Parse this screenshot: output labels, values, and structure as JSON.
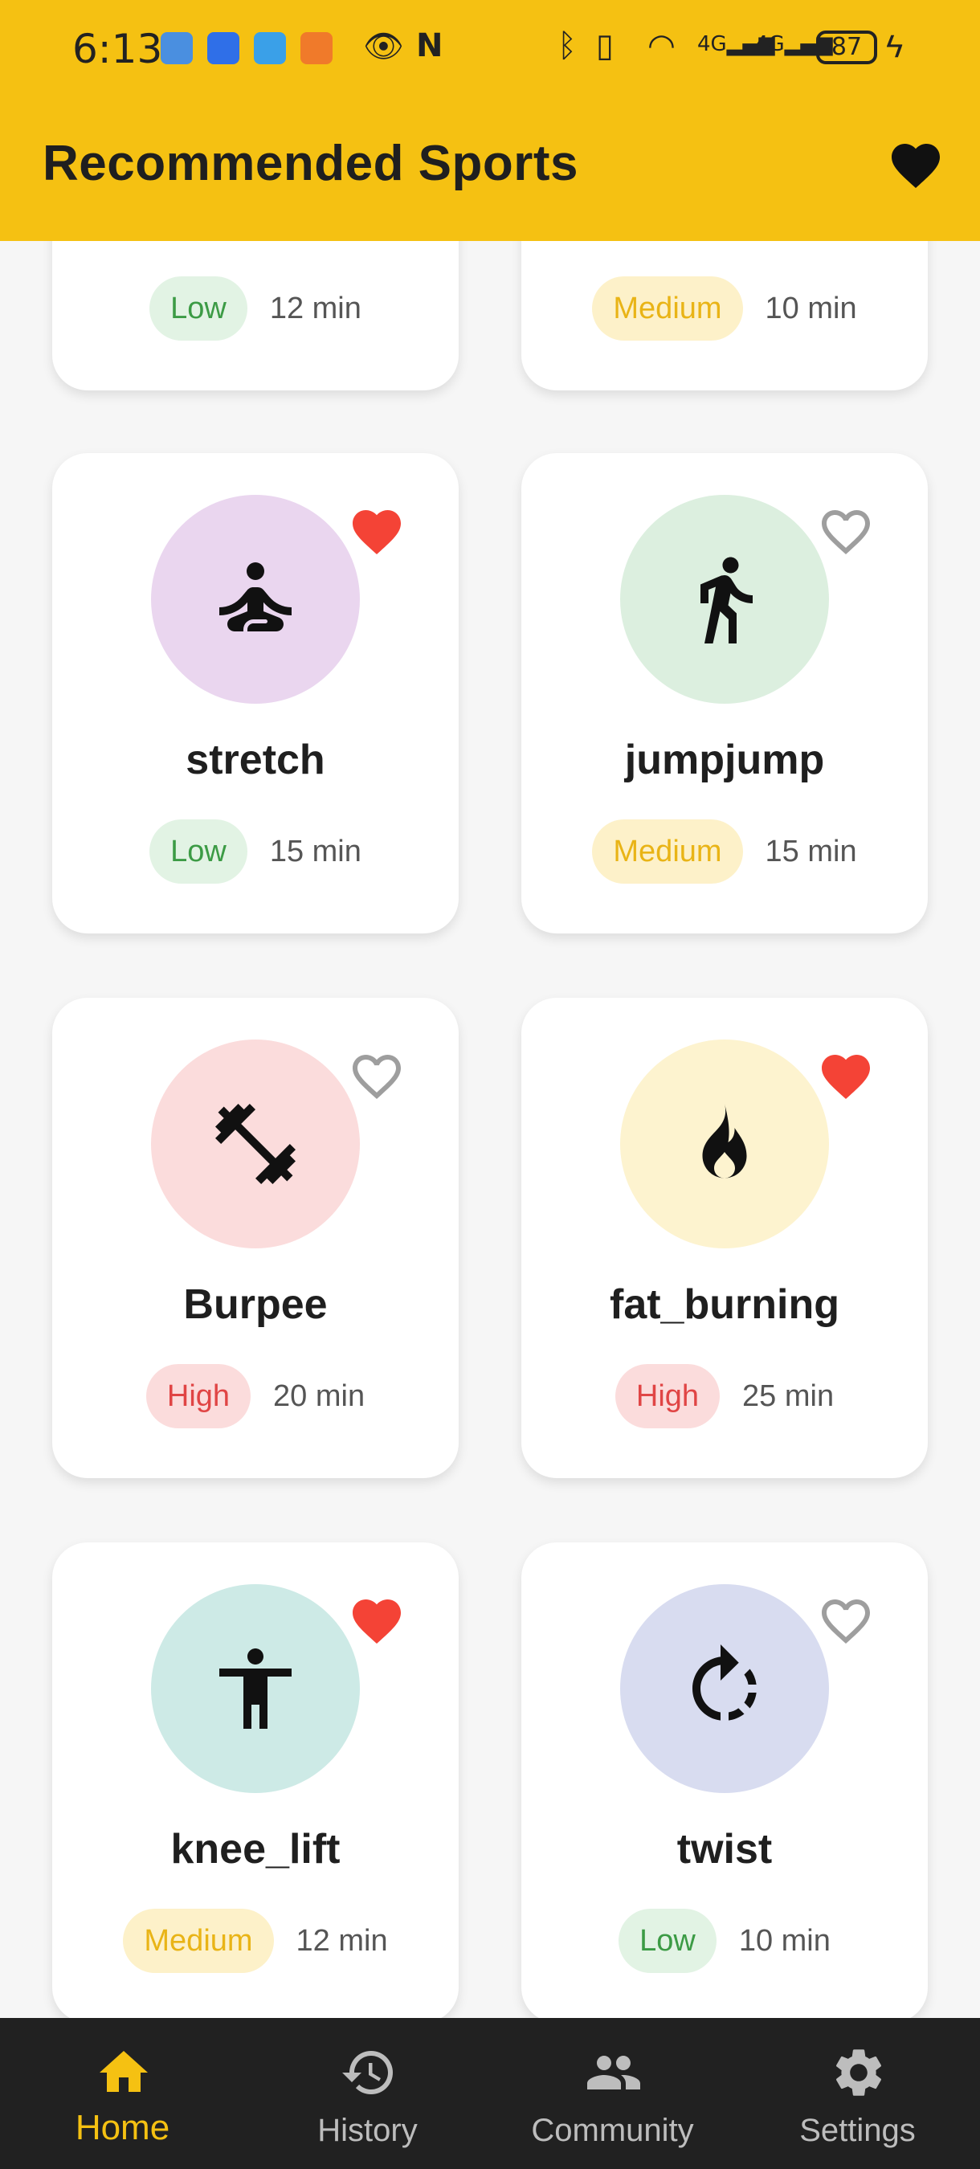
{
  "status_bar": {
    "time": "6:13",
    "battery": "87"
  },
  "header": {
    "title": "Recommended Sports",
    "favorites_icon": "heart-icon"
  },
  "cards": [
    {
      "name": "",
      "level": "Low",
      "level_class": "low",
      "duration": "12 min",
      "favorited": false,
      "icon": "hidden"
    },
    {
      "name": "",
      "level": "Medium",
      "level_class": "medium",
      "duration": "10 min",
      "favorited": false,
      "icon": "hidden"
    },
    {
      "name": "stretch",
      "level": "Low",
      "level_class": "low",
      "duration": "15 min",
      "favorited": true,
      "icon": "meditation-icon",
      "circle_color": "#ead6ef"
    },
    {
      "name": "jumpjump",
      "level": "Medium",
      "level_class": "medium",
      "duration": "15 min",
      "favorited": false,
      "icon": "walking-icon",
      "circle_color": "#dcefdf"
    },
    {
      "name": "Burpee",
      "level": "High",
      "level_class": "high",
      "duration": "20 min",
      "favorited": false,
      "icon": "dumbbell-icon",
      "circle_color": "#fbdcdc"
    },
    {
      "name": "fat_burning",
      "level": "High",
      "level_class": "high",
      "duration": "25 min",
      "favorited": true,
      "icon": "fire-icon",
      "circle_color": "#fdf3cf"
    },
    {
      "name": "knee_lift",
      "level": "Medium",
      "level_class": "medium",
      "duration": "12 min",
      "favorited": true,
      "icon": "accessibility-icon",
      "circle_color": "#cdeae6"
    },
    {
      "name": "twist",
      "level": "Low",
      "level_class": "low",
      "duration": "10 min",
      "favorited": false,
      "icon": "rotate-icon",
      "circle_color": "#d8dcf0"
    }
  ],
  "bottom_nav": {
    "items": [
      {
        "label": "Home",
        "icon": "home-icon",
        "active": true
      },
      {
        "label": "History",
        "icon": "history-icon",
        "active": false
      },
      {
        "label": "Community",
        "icon": "people-icon",
        "active": false
      },
      {
        "label": "Settings",
        "icon": "gear-icon",
        "active": false
      }
    ]
  },
  "colors": {
    "accent": "#f5c112",
    "favorite_red": "#f44336",
    "nav_background": "#212121"
  }
}
